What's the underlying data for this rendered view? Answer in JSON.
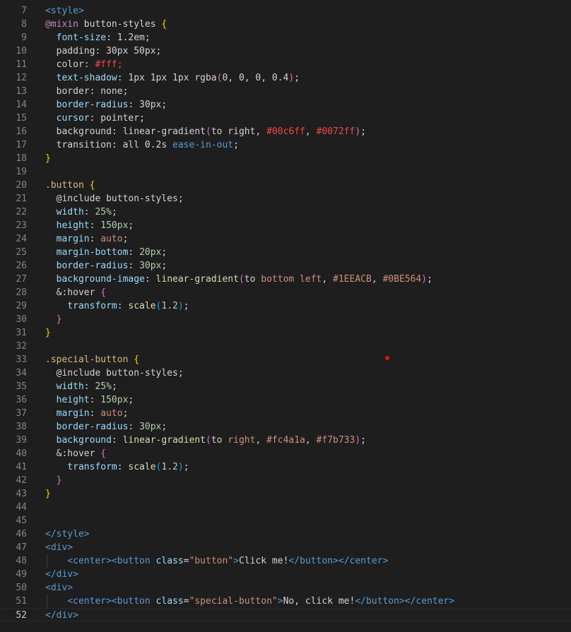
{
  "editor": {
    "colors": {
      "background": "#1e1e1e",
      "line_number": "#858585",
      "default": "#d4d4d4",
      "tag": "#569cd6",
      "attr": "#9cdcfe",
      "string": "#ce9178",
      "at_rule": "#c586c0",
      "selector": "#d7ba7d",
      "number": "#b5cea8",
      "function": "#dcdcaa",
      "bracket": "#ffd700",
      "bracket2": "#da70d6",
      "bracket3": "#179fff",
      "red": "#f44747"
    },
    "lines": [
      {
        "num": "7",
        "segments": [
          {
            "t": "<style>",
            "c": "tag"
          }
        ]
      },
      {
        "num": "8",
        "segments": [
          {
            "t": "@mixin",
            "c": "at_rule"
          },
          {
            "t": " button-styles ",
            "c": "default"
          },
          {
            "t": "{",
            "c": "bracket"
          }
        ]
      },
      {
        "num": "9",
        "segments": [
          {
            "t": "  font-size",
            "c": "attr"
          },
          {
            "t": ": 1.2em;",
            "c": "default"
          }
        ]
      },
      {
        "num": "10",
        "segments": [
          {
            "t": "  padding: 30px 50px;",
            "c": "default"
          }
        ]
      },
      {
        "num": "11",
        "segments": [
          {
            "t": "  color: ",
            "c": "default"
          },
          {
            "t": "#fff;",
            "c": "red"
          }
        ]
      },
      {
        "num": "12",
        "segments": [
          {
            "t": "  text-shadow",
            "c": "attr"
          },
          {
            "t": ": 1px 1px 1px rgba",
            "c": "default"
          },
          {
            "t": "(",
            "c": "bracket2"
          },
          {
            "t": "0, 0, 0, 0.4",
            "c": "default"
          },
          {
            "t": ")",
            "c": "bracket2"
          },
          {
            "t": ";",
            "c": "default"
          }
        ]
      },
      {
        "num": "13",
        "segments": [
          {
            "t": "  border: none;",
            "c": "default"
          }
        ]
      },
      {
        "num": "14",
        "segments": [
          {
            "t": "  border-radius",
            "c": "attr"
          },
          {
            "t": ": 30px;",
            "c": "default"
          }
        ]
      },
      {
        "num": "15",
        "segments": [
          {
            "t": "  cursor",
            "c": "attr"
          },
          {
            "t": ": pointer;",
            "c": "default"
          }
        ]
      },
      {
        "num": "16",
        "segments": [
          {
            "t": "  background: linear-gradient",
            "c": "default"
          },
          {
            "t": "(",
            "c": "bracket2"
          },
          {
            "t": "to right, ",
            "c": "default"
          },
          {
            "t": "#00c6ff",
            "c": "red"
          },
          {
            "t": ", ",
            "c": "default"
          },
          {
            "t": "#0072ff",
            "c": "red"
          },
          {
            "t": ")",
            "c": "bracket2"
          },
          {
            "t": ";",
            "c": "default"
          }
        ]
      },
      {
        "num": "17",
        "segments": [
          {
            "t": "  transition: all 0.2s ",
            "c": "default"
          },
          {
            "t": "ease-in-out",
            "c": "tag"
          },
          {
            "t": ";",
            "c": "default"
          }
        ]
      },
      {
        "num": "18",
        "segments": [
          {
            "t": "}",
            "c": "bracket"
          }
        ]
      },
      {
        "num": "19",
        "segments": []
      },
      {
        "num": "20",
        "segments": [
          {
            "t": ".button ",
            "c": "selector"
          },
          {
            "t": "{",
            "c": "bracket"
          }
        ]
      },
      {
        "num": "21",
        "segments": [
          {
            "t": "  @include button-styles;",
            "c": "default"
          }
        ]
      },
      {
        "num": "22",
        "segments": [
          {
            "t": "  width",
            "c": "attr"
          },
          {
            "t": ": ",
            "c": "default"
          },
          {
            "t": "25%",
            "c": "number"
          },
          {
            "t": ";",
            "c": "default"
          }
        ]
      },
      {
        "num": "23",
        "segments": [
          {
            "t": "  height",
            "c": "attr"
          },
          {
            "t": ": ",
            "c": "default"
          },
          {
            "t": "150px",
            "c": "number"
          },
          {
            "t": ";",
            "c": "default"
          }
        ]
      },
      {
        "num": "24",
        "segments": [
          {
            "t": "  margin",
            "c": "attr"
          },
          {
            "t": ": ",
            "c": "default"
          },
          {
            "t": "auto",
            "c": "string"
          },
          {
            "t": ";",
            "c": "default"
          }
        ]
      },
      {
        "num": "25",
        "segments": [
          {
            "t": "  margin-bottom",
            "c": "attr"
          },
          {
            "t": ": ",
            "c": "default"
          },
          {
            "t": "20px",
            "c": "number"
          },
          {
            "t": ";",
            "c": "default"
          }
        ]
      },
      {
        "num": "26",
        "segments": [
          {
            "t": "  border-radius",
            "c": "attr"
          },
          {
            "t": ": ",
            "c": "default"
          },
          {
            "t": "30px",
            "c": "number"
          },
          {
            "t": ";",
            "c": "default"
          }
        ]
      },
      {
        "num": "27",
        "segments": [
          {
            "t": "  background-image",
            "c": "attr"
          },
          {
            "t": ": ",
            "c": "default"
          },
          {
            "t": "linear-gradient",
            "c": "function"
          },
          {
            "t": "(",
            "c": "bracket2"
          },
          {
            "t": "to ",
            "c": "default"
          },
          {
            "t": "bottom left",
            "c": "string"
          },
          {
            "t": ", ",
            "c": "default"
          },
          {
            "t": "#1EEACB",
            "c": "string"
          },
          {
            "t": ", ",
            "c": "default"
          },
          {
            "t": "#0BE564",
            "c": "string"
          },
          {
            "t": ")",
            "c": "bracket2"
          },
          {
            "t": ";",
            "c": "default"
          }
        ]
      },
      {
        "num": "28",
        "segments": [
          {
            "t": "  &:hover ",
            "c": "default"
          },
          {
            "t": "{",
            "c": "bracket2"
          }
        ]
      },
      {
        "num": "29",
        "segments": [
          {
            "t": "    transform",
            "c": "attr"
          },
          {
            "t": ": ",
            "c": "default"
          },
          {
            "t": "scale",
            "c": "function"
          },
          {
            "t": "(",
            "c": "bracket3"
          },
          {
            "t": "1.2",
            "c": "number"
          },
          {
            "t": ")",
            "c": "bracket3"
          },
          {
            "t": ";",
            "c": "default"
          }
        ]
      },
      {
        "num": "30",
        "segments": [
          {
            "t": "  }",
            "c": "bracket2"
          }
        ]
      },
      {
        "num": "31",
        "segments": [
          {
            "t": "}",
            "c": "bracket"
          }
        ]
      },
      {
        "num": "32",
        "segments": []
      },
      {
        "num": "33",
        "segments": [
          {
            "t": ".special-button ",
            "c": "selector"
          },
          {
            "t": "{",
            "c": "bracket"
          }
        ]
      },
      {
        "num": "34",
        "segments": [
          {
            "t": "  @include button-styles;",
            "c": "default"
          }
        ]
      },
      {
        "num": "35",
        "segments": [
          {
            "t": "  width",
            "c": "attr"
          },
          {
            "t": ": ",
            "c": "default"
          },
          {
            "t": "25%",
            "c": "number"
          },
          {
            "t": ";",
            "c": "default"
          }
        ]
      },
      {
        "num": "36",
        "segments": [
          {
            "t": "  height",
            "c": "attr"
          },
          {
            "t": ": ",
            "c": "default"
          },
          {
            "t": "150px",
            "c": "number"
          },
          {
            "t": ";",
            "c": "default"
          }
        ]
      },
      {
        "num": "37",
        "segments": [
          {
            "t": "  margin",
            "c": "attr"
          },
          {
            "t": ": ",
            "c": "default"
          },
          {
            "t": "auto",
            "c": "string"
          },
          {
            "t": ";",
            "c": "default"
          }
        ]
      },
      {
        "num": "38",
        "segments": [
          {
            "t": "  border-radius",
            "c": "attr"
          },
          {
            "t": ": ",
            "c": "default"
          },
          {
            "t": "30px",
            "c": "number"
          },
          {
            "t": ";",
            "c": "default"
          }
        ]
      },
      {
        "num": "39",
        "segments": [
          {
            "t": "  background",
            "c": "attr"
          },
          {
            "t": ": ",
            "c": "default"
          },
          {
            "t": "linear-gradient",
            "c": "function"
          },
          {
            "t": "(",
            "c": "bracket2"
          },
          {
            "t": "to ",
            "c": "default"
          },
          {
            "t": "right",
            "c": "string"
          },
          {
            "t": ", ",
            "c": "default"
          },
          {
            "t": "#fc4a1a",
            "c": "string"
          },
          {
            "t": ", ",
            "c": "default"
          },
          {
            "t": "#f7b733",
            "c": "string"
          },
          {
            "t": ")",
            "c": "bracket2"
          },
          {
            "t": ";",
            "c": "default"
          }
        ]
      },
      {
        "num": "40",
        "segments": [
          {
            "t": "  &:hover ",
            "c": "default"
          },
          {
            "t": "{",
            "c": "bracket2"
          }
        ]
      },
      {
        "num": "41",
        "segments": [
          {
            "t": "    transform",
            "c": "attr"
          },
          {
            "t": ": ",
            "c": "default"
          },
          {
            "t": "scale",
            "c": "function"
          },
          {
            "t": "(",
            "c": "bracket3"
          },
          {
            "t": "1.2",
            "c": "number"
          },
          {
            "t": ")",
            "c": "bracket3"
          },
          {
            "t": ";",
            "c": "default"
          }
        ]
      },
      {
        "num": "42",
        "segments": [
          {
            "t": "  }",
            "c": "bracket2"
          }
        ]
      },
      {
        "num": "43",
        "segments": [
          {
            "t": "}",
            "c": "bracket"
          }
        ]
      },
      {
        "num": "44",
        "segments": []
      },
      {
        "num": "45",
        "segments": []
      },
      {
        "num": "46",
        "segments": [
          {
            "t": "</style>",
            "c": "tag"
          }
        ]
      },
      {
        "num": "47",
        "segments": [
          {
            "t": "<div>",
            "c": "tag"
          }
        ]
      },
      {
        "num": "48",
        "guide": true,
        "segments": [
          {
            "t": "    ",
            "c": "default"
          },
          {
            "t": "<center><button ",
            "c": "tag"
          },
          {
            "t": "class",
            "c": "attr"
          },
          {
            "t": "=",
            "c": "default"
          },
          {
            "t": "\"button\"",
            "c": "string"
          },
          {
            "t": ">",
            "c": "tag"
          },
          {
            "t": "Click me!",
            "c": "default"
          },
          {
            "t": "</button></center>",
            "c": "tag"
          }
        ]
      },
      {
        "num": "49",
        "segments": [
          {
            "t": "</div>",
            "c": "tag"
          }
        ]
      },
      {
        "num": "50",
        "segments": [
          {
            "t": "<div>",
            "c": "tag"
          }
        ]
      },
      {
        "num": "51",
        "guide": true,
        "segments": [
          {
            "t": "    ",
            "c": "default"
          },
          {
            "t": "<center><button ",
            "c": "tag"
          },
          {
            "t": "class",
            "c": "attr"
          },
          {
            "t": "=",
            "c": "default"
          },
          {
            "t": "\"special-button\"",
            "c": "string"
          },
          {
            "t": ">",
            "c": "tag"
          },
          {
            "t": "No, click me!",
            "c": "default"
          },
          {
            "t": "</button></center>",
            "c": "tag"
          }
        ]
      },
      {
        "num": "52",
        "active": true,
        "segments": [
          {
            "t": "</div>",
            "c": "tag"
          }
        ]
      }
    ]
  }
}
